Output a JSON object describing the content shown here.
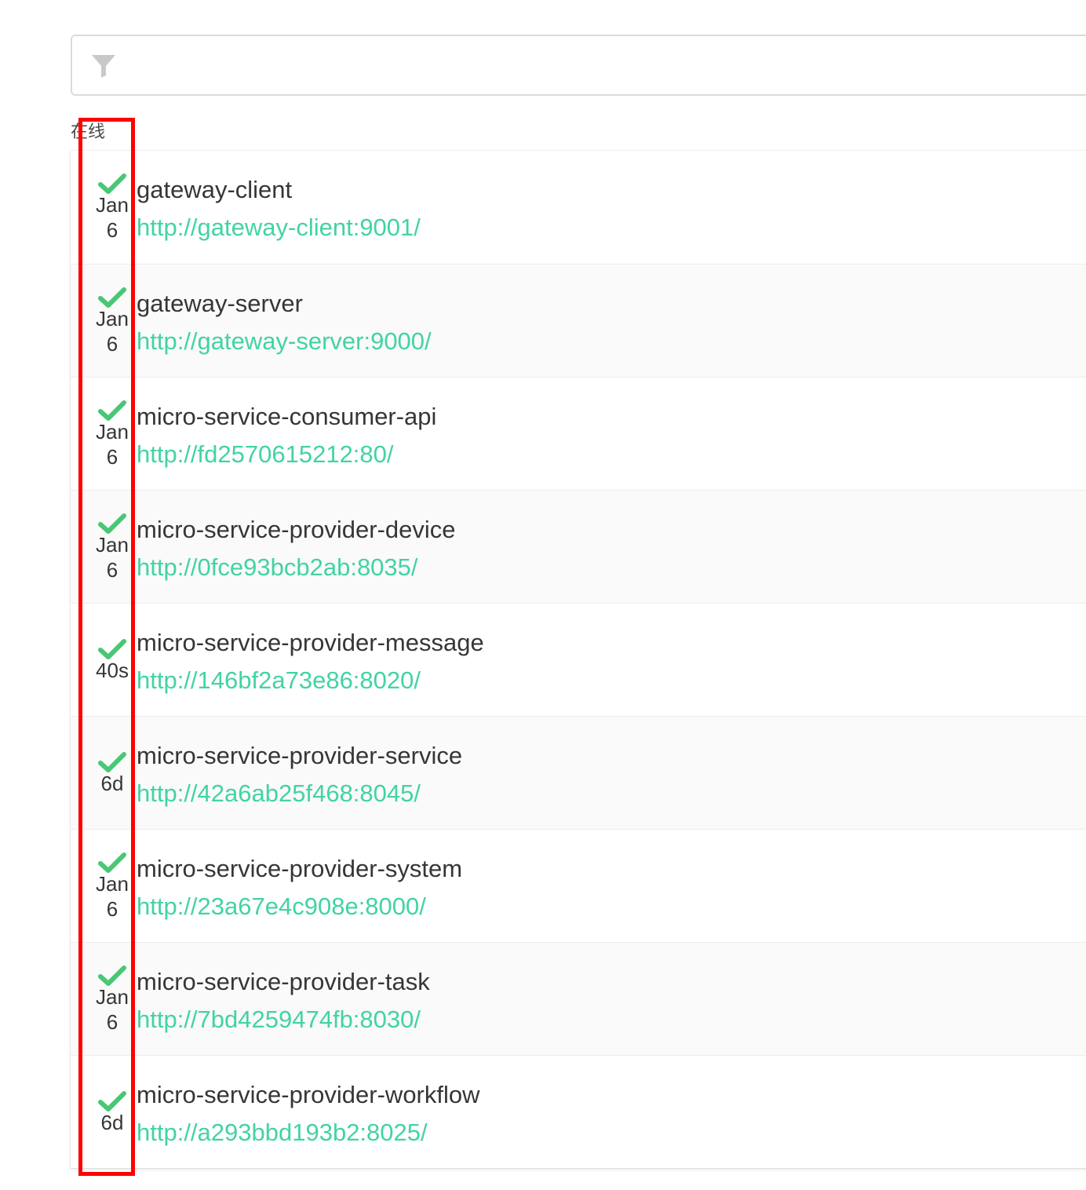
{
  "filter": {
    "icon": "filter-icon",
    "value": "",
    "placeholder": ""
  },
  "section": {
    "title": "在线"
  },
  "colors": {
    "status_up": "#48c774",
    "url": "#42d3a5",
    "highlight": "#ff0000"
  },
  "applications": [
    {
      "name": "gateway-client",
      "url": "http://gateway-client:9001/",
      "status_icon": "check-icon",
      "since": "Jan 6"
    },
    {
      "name": "gateway-server",
      "url": "http://gateway-server:9000/",
      "status_icon": "check-icon",
      "since": "Jan 6"
    },
    {
      "name": "micro-service-consumer-api",
      "url": "http://fd2570615212:80/",
      "status_icon": "check-icon",
      "since": "Jan 6"
    },
    {
      "name": "micro-service-provider-device",
      "url": "http://0fce93bcb2ab:8035/",
      "status_icon": "check-icon",
      "since": "Jan 6"
    },
    {
      "name": "micro-service-provider-message",
      "url": "http://146bf2a73e86:8020/",
      "status_icon": "check-icon",
      "since": "40s"
    },
    {
      "name": "micro-service-provider-service",
      "url": "http://42a6ab25f468:8045/",
      "status_icon": "check-icon",
      "since": "6d"
    },
    {
      "name": "micro-service-provider-system",
      "url": "http://23a67e4c908e:8000/",
      "status_icon": "check-icon",
      "since": "Jan 6"
    },
    {
      "name": "micro-service-provider-task",
      "url": "http://7bd4259474fb:8030/",
      "status_icon": "check-icon",
      "since": "Jan 6"
    },
    {
      "name": "micro-service-provider-workflow",
      "url": "http://a293bbd193b2:8025/",
      "status_icon": "check-icon",
      "since": "6d"
    }
  ]
}
